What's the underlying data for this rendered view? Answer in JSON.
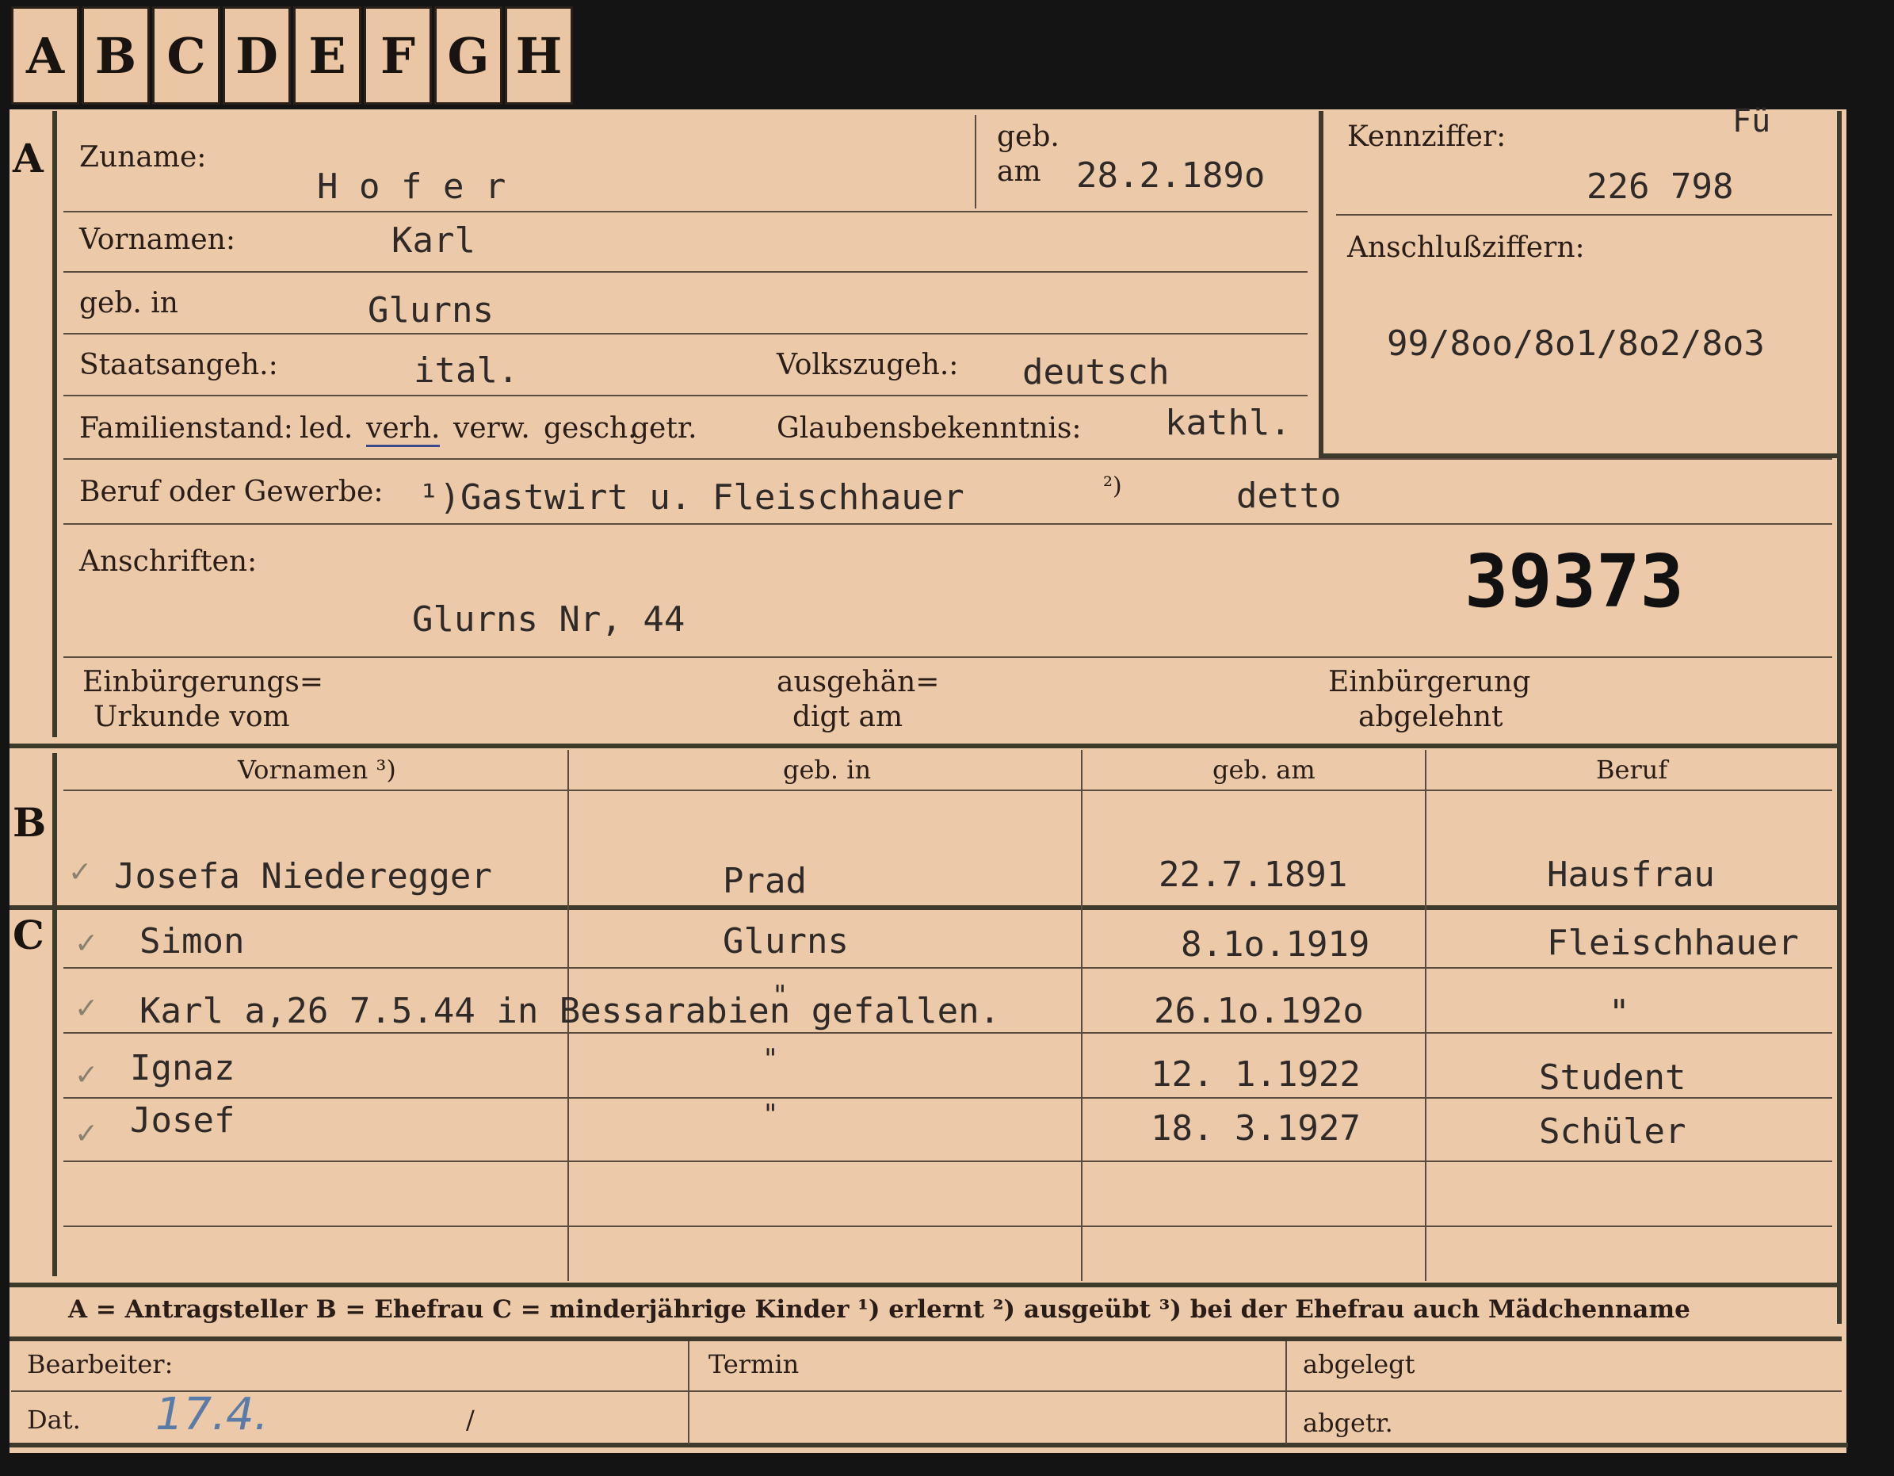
{
  "tabs": [
    "A",
    "B",
    "C",
    "D",
    "E",
    "F",
    "G",
    "H"
  ],
  "sections": {
    "a": "A",
    "b": "B",
    "c": "C"
  },
  "labels": {
    "zuname": "Zuname:",
    "geb_am_top": "geb.",
    "geb_am_bottom": "am",
    "kennziffer": "Kennziffer:",
    "vornamen": "Vornamen:",
    "anschlussziffern": "Anschlußziffern:",
    "geb_in": "geb. in",
    "staatsangeh": "Staatsangeh.:",
    "volkszugeh": "Volkszugeh.:",
    "familienstand": "Familienstand:",
    "fam_options": [
      "led.",
      "verh.",
      "verw.",
      "gesch.",
      "getr."
    ],
    "glaubensbekenntnis": "Glaubensbekenntnis:",
    "beruf": "Beruf oder Gewerbe:",
    "anschriften": "Anschriften:",
    "einbuergerung_urkunde_1": "Einbürgerungs=",
    "einbuergerung_urkunde_2": "Urkunde vom",
    "ausgehaendigt_1": "ausgehän=",
    "ausgehaendigt_2": "digt am",
    "einbuergerung_abgelehnt_1": "Einbürgerung",
    "einbuergerung_abgelehnt_2": "abgelehnt"
  },
  "values": {
    "zuname": "H o f e r",
    "geb_am": "28.2.189o",
    "kennziffer_top": "Fü",
    "kennziffer": "226 798",
    "vornamen": "Karl",
    "anschlussziffern": "99/8oo/8o1/8o2/8o3",
    "geb_in": "Glurns",
    "staatsangeh": "ital.",
    "volkszugeh": "deutsch",
    "glaubensbekenntnis": "kathl.",
    "beruf_1": "¹)Gastwirt u. Fleischhauer",
    "beruf_2_mark": "²)",
    "beruf_2": "detto",
    "anschrift": "Glurns  Nr, 44",
    "stamp": "39373"
  },
  "b_table": {
    "headers": [
      "Vornamen ³)",
      "geb. in",
      "geb. am",
      "Beruf"
    ],
    "row": [
      "Josefa  Niederegger",
      "Prad",
      "22.7.1891",
      "Hausfrau"
    ]
  },
  "c_table": {
    "rows": [
      [
        "Simon",
        "Glurns",
        "8.1o.1919",
        "Fleischhauer"
      ],
      [
        "Karl a,26 7.5.44 in Bessarabien gefallen.",
        "\"",
        "26.1o.192o",
        "\""
      ],
      [
        "Ignaz",
        "\"",
        "12. 1.1922",
        "Student"
      ],
      [
        "Josef",
        "\"",
        "18. 3.1927",
        "Schüler"
      ]
    ]
  },
  "legend": "A = Antragsteller   B = Ehefrau   C = minderjährige Kinder   ¹) erlernt   ²) ausgeübt   ³) bei der Ehefrau auch Mädchenname",
  "footer": {
    "bearbeiter": "Bearbeiter:",
    "termin": "Termin",
    "abgelegt": "abgelegt",
    "dat": "Dat.",
    "abgetr": "abgetr.",
    "handwritten_date": "17.4.",
    "slash": "/"
  },
  "colors": {
    "card": "#ecc9a8",
    "frame": "#3d3a2c",
    "background": "#141414",
    "pencil": "#5a7aa8"
  }
}
